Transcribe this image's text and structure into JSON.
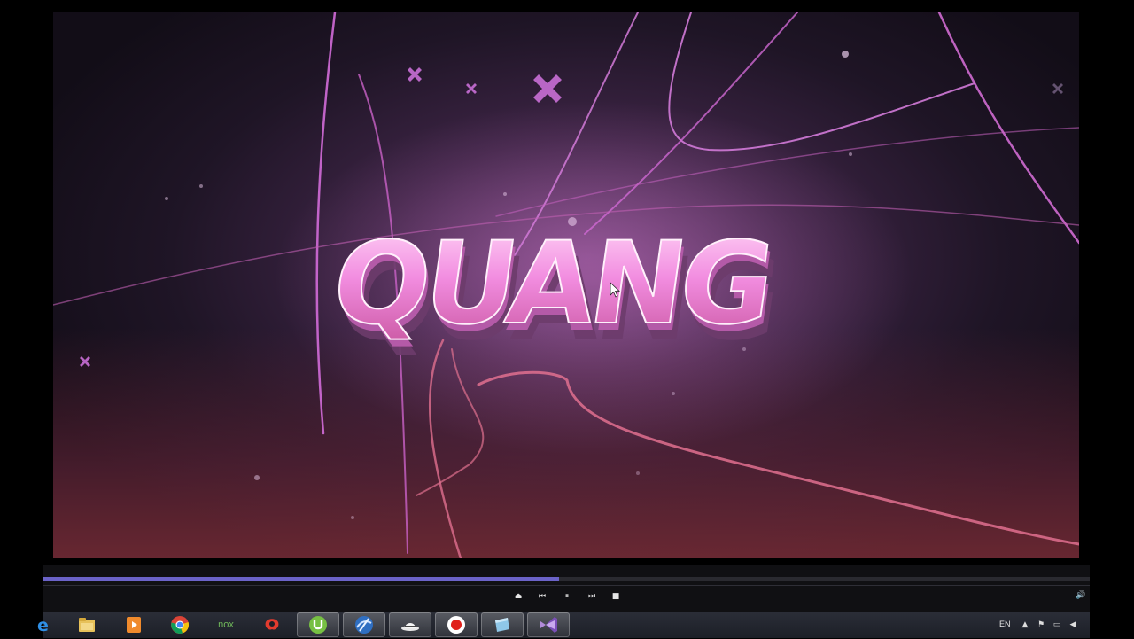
{
  "video": {
    "title_text": "QUANG"
  },
  "player": {
    "progress": 0.493,
    "controls": [
      {
        "name": "eject-button",
        "glyph": "⏏"
      },
      {
        "name": "previous-button",
        "glyph": "⏮"
      },
      {
        "name": "pause-button",
        "glyph": "⏸"
      },
      {
        "name": "next-button",
        "glyph": "⏭"
      },
      {
        "name": "stop-button",
        "glyph": "■"
      }
    ],
    "volume_glyph": "🔊"
  },
  "taskbar": {
    "apps": [
      {
        "name": "internet-explorer-icon"
      },
      {
        "name": "file-explorer-icon"
      },
      {
        "name": "media-player-icon"
      },
      {
        "name": "chrome-icon"
      },
      {
        "name": "nox-icon",
        "label": "nox"
      },
      {
        "name": "garena-icon"
      },
      {
        "name": "utorrent-icon"
      },
      {
        "name": "settings-globe-icon"
      },
      {
        "name": "hat-icon"
      },
      {
        "name": "record-icon"
      },
      {
        "name": "window-icon"
      },
      {
        "name": "visual-studio-icon"
      }
    ],
    "tray": {
      "language": "EN",
      "icons": [
        "chevron-up-icon",
        "flag-icon",
        "network-icon",
        "volume-icon"
      ]
    }
  },
  "colors": {
    "accent": "#6b63c8",
    "text_pink": "#f4a8e8"
  }
}
